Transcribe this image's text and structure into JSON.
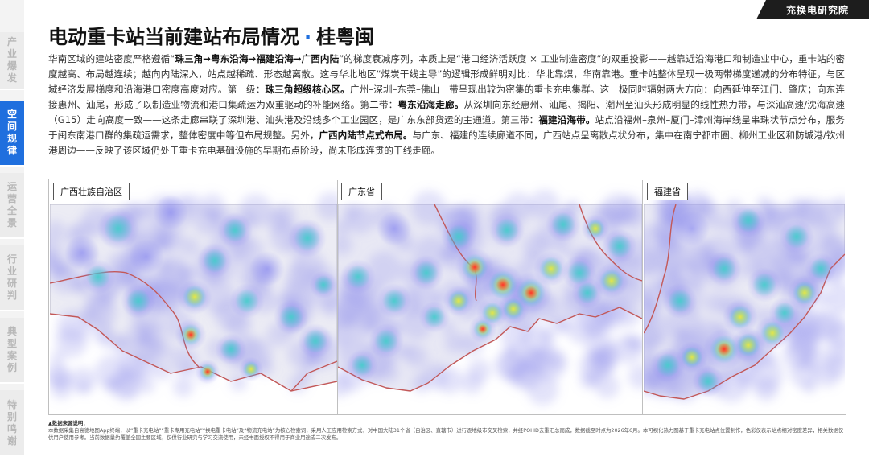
{
  "brand": "充换电研究院",
  "sidebar": {
    "items": [
      {
        "label": "产业爆发",
        "chars": [
          "产",
          "业",
          "爆",
          "发"
        ],
        "active": false
      },
      {
        "label": "空间规律",
        "chars": [
          "空",
          "间",
          "规",
          "律"
        ],
        "active": true
      },
      {
        "label": "运营全景",
        "chars": [
          "运",
          "营",
          "全",
          "景"
        ],
        "active": false
      },
      {
        "label": "行业研判",
        "chars": [
          "行",
          "业",
          "研",
          "判"
        ],
        "active": false
      },
      {
        "label": "典型案例",
        "chars": [
          "典",
          "型",
          "案",
          "例"
        ],
        "active": false
      },
      {
        "label": "特别鸣谢",
        "chars": [
          "特",
          "别",
          "鸣",
          "谢"
        ],
        "active": false
      }
    ]
  },
  "page": {
    "title_main": "电动重卡站当前建站布局情况",
    "title_sep": "·",
    "title_region": "桂粤闽"
  },
  "paragraph": {
    "t1": "华南区域的建站密度严格遵循“",
    "b1": "珠三角→粤东沿海→福建沿海→广西内陆",
    "t2": "”的梯度衰减序列，本质上是“港口经济活跃度 × 工业制造密度”的双重投影——越靠近沿海港口和制造业中心，重卡站的密度越高、布局越连续；越向内陆深入，站点越稀疏、形态越离散。这与华北地区“煤炭干线主导”的逻辑形成鲜明对比：华北靠煤，华南靠港。重卡站整体呈现一极两带梯度递减的分布特征，与区域经济发展梯度和沿海港口密度高度对应。第一级：",
    "b2": "珠三角超级核心区。",
    "t3": "广州–深圳–东莞–佛山一带呈现出较为密集的重卡充电集群。这一极同时辐射两大方向：向西延伸至江门、肇庆；向东连接惠州、汕尾，形成了以制造业物流和港口集疏运为双重驱动的补能网络。第二带：",
    "b3": "粤东沿海走廊。",
    "t4": "从深圳向东经惠州、汕尾、揭阳、潮州至汕头形成明显的线性热力带，与深汕高速/沈海高速（G15）走向高度一致——这条走廊串联了深圳港、汕头港及沿线多个工业园区，是广东东部货运的主通道。第三带：",
    "b4": "福建沿海带。",
    "t5": "站点沿福州–泉州–厦门–漳州海岸线呈串珠状节点分布，服务于闽东南港口群的集疏运需求，整体密度中等但布局规整。另外，",
    "b5": "广西内陆节点式布局。",
    "t6": "与广东、福建的连续廊道不同，广西站点呈离散点状分布，集中在南宁都市圈、柳州工业区和防城港/钦州港周边——反映了该区域仍处于重卡充电基础设施的早期布点阶段，尚未形成连贯的干线走廊。"
  },
  "maps": [
    {
      "label": "广西壮族自治区",
      "palette": {
        "sea": "#ffffff",
        "land": "#ececf4",
        "border": "#c35858",
        "haze": "#9c9cec"
      }
    },
    {
      "label": "广东省",
      "palette": {
        "sea": "#ffffff",
        "land": "#e8e8f4",
        "border": "#c35858",
        "haze": "#9c9cec"
      }
    },
    {
      "label": "福建省",
      "palette": {
        "sea": "#ffffff",
        "land": "#eaeaf4",
        "border": "#c35858",
        "haze": "#9c9cec"
      }
    }
  ],
  "heat_colors": {
    "low": "#7a7af0",
    "mid": "#3fd3c8",
    "high": "#f7e83a",
    "peak": "#ff2a2a"
  },
  "footnote": {
    "head": "▲数据来源说明：",
    "body": "本数据采集自高德地图App终端，以“重卡充电站”“重卡专用充电站”“换电重卡电站”及“物流充电站”为核心检索词，采用人工应用检索方式，对中国大陆31个省（自治区、直辖市）进行逐地级市交叉检索，并经POI ID去重汇总而成，数据截至时点为2026年6月。本可视化热力图基于重卡充电站点位置制作，色彩仅表示站点相对密度差异，相关数据仅供用户使用参考。当前数据量约覆盖全国主要区域，仅供行业研究与学习交流使用，未经书面授权不得用于商业用途或二次发布。"
  }
}
